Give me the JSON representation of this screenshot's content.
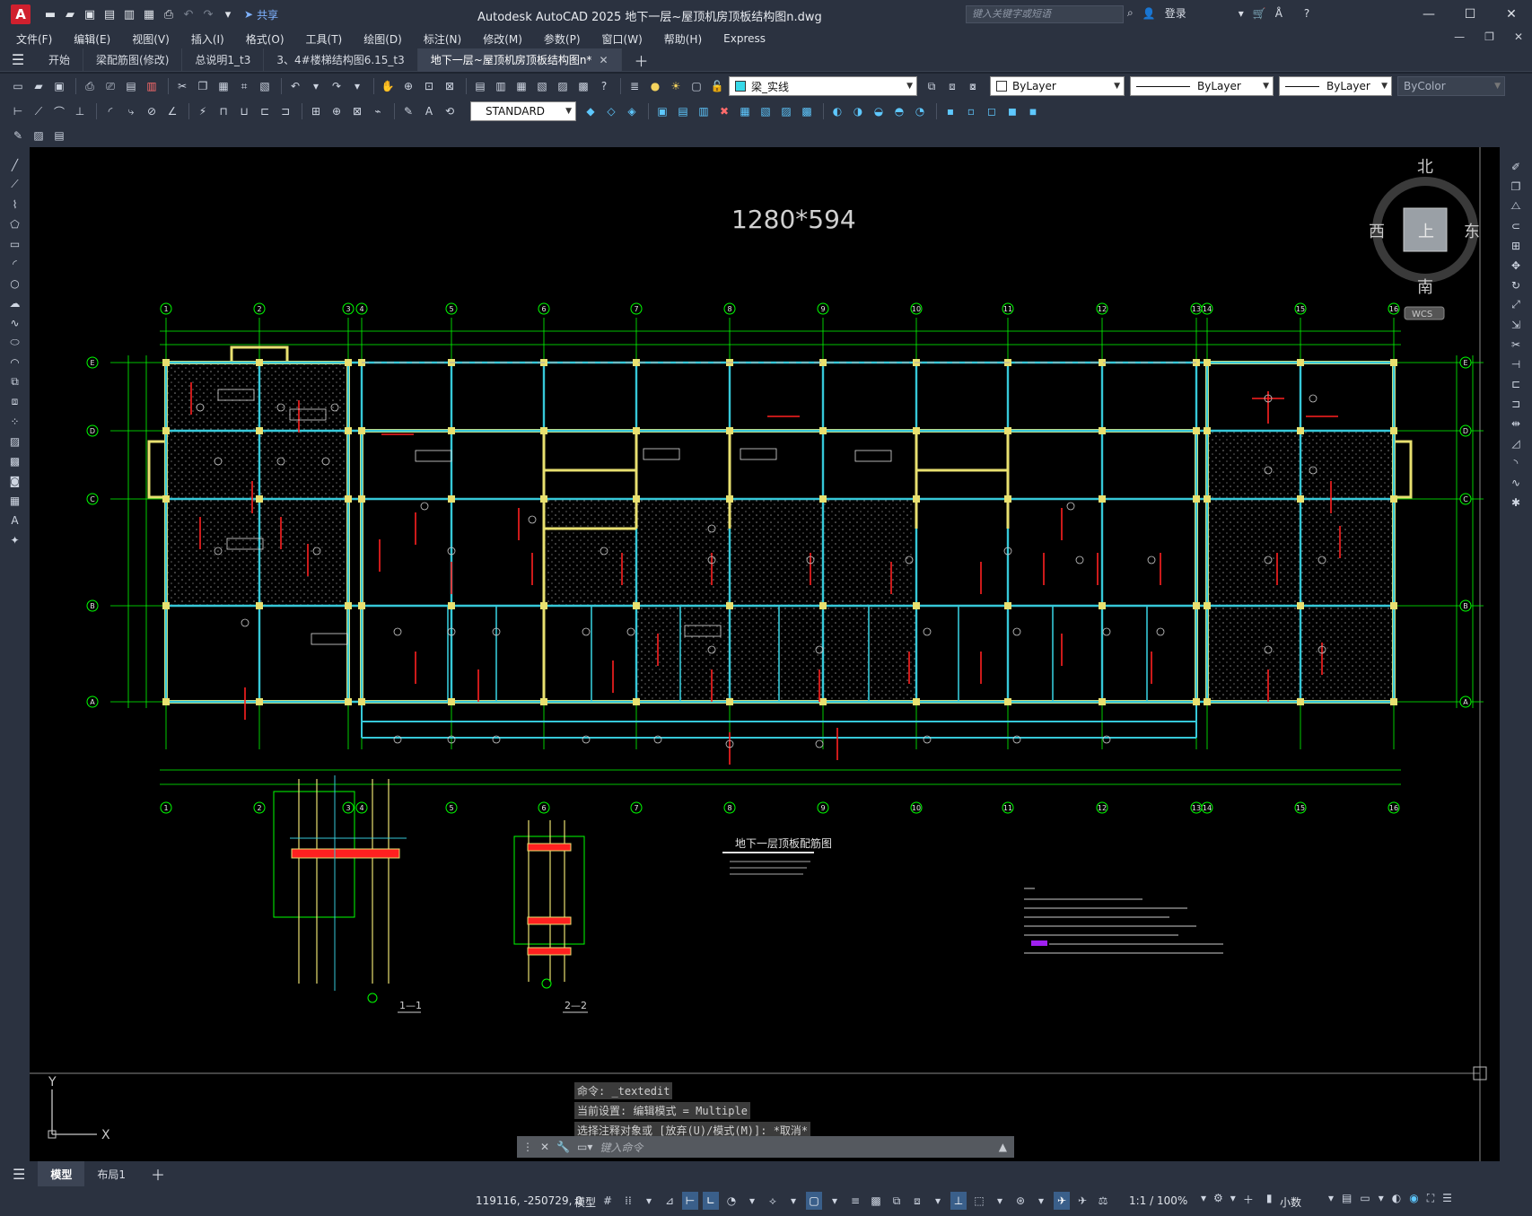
{
  "app": {
    "title": "Autodesk AutoCAD 2025    地下一层~屋顶机房顶板结构图n.dwg",
    "logo_letter": "A",
    "share_label": "共享",
    "search_placeholder": "键入关键字或短语",
    "login_label": "登录"
  },
  "menu": [
    "文件(F)",
    "编辑(E)",
    "视图(V)",
    "插入(I)",
    "格式(O)",
    "工具(T)",
    "绘图(D)",
    "标注(N)",
    "修改(M)",
    "参数(P)",
    "窗口(W)",
    "帮助(H)",
    "Express"
  ],
  "tabs": [
    {
      "label": "开始",
      "active": false
    },
    {
      "label": "梁配筋图(修改)",
      "active": false
    },
    {
      "label": "总说明1_t3",
      "active": false
    },
    {
      "label": "3、4#楼梯结构图6.15_t3",
      "active": false
    },
    {
      "label": "地下一层~屋顶机房顶板结构图n*",
      "active": true
    }
  ],
  "toolbar": {
    "layer_name": "梁_实线",
    "color": "ByLayer",
    "linetype": "ByLayer",
    "lineweight": "ByLayer",
    "plotstyle": "ByColor",
    "textstyle": "STANDARD"
  },
  "drawing": {
    "size_label": "1280*594",
    "plan_title": "地下一层顶板配筋图",
    "section_1": "1—1",
    "section_2": "2—2",
    "grid_cols": [
      "1",
      "2",
      "3",
      "4",
      "5",
      "6",
      "7",
      "8",
      "9",
      "10",
      "11",
      "12",
      "13",
      "14",
      "15",
      "16"
    ],
    "grid_rows": [
      "E",
      "D",
      "C",
      "B",
      "A"
    ]
  },
  "viewcube": {
    "north": "北",
    "south": "南",
    "east": "东",
    "west": "西",
    "face": "上",
    "wcs": "WCS"
  },
  "ucs": {
    "y": "Y",
    "x": "X"
  },
  "command": {
    "history": [
      "命令: _textedit",
      "当前设置: 编辑模式 = Multiple",
      "选择注释对象或 [放弃(U)/模式(M)]: *取消*"
    ],
    "placeholder": "键入命令"
  },
  "layouts": [
    {
      "label": "模型",
      "active": true
    },
    {
      "label": "布局1",
      "active": false
    }
  ],
  "status": {
    "coords": "119116, -250729, 0",
    "space": "模型",
    "scale": "1:1 / 100%",
    "units": "小数"
  },
  "colors": {
    "grid_green": "#00ff00",
    "wall_yellow": "#e8e070",
    "beam_cyan": "#36c8d8",
    "rebar_red": "#ff2020",
    "hatch": "#777777"
  }
}
